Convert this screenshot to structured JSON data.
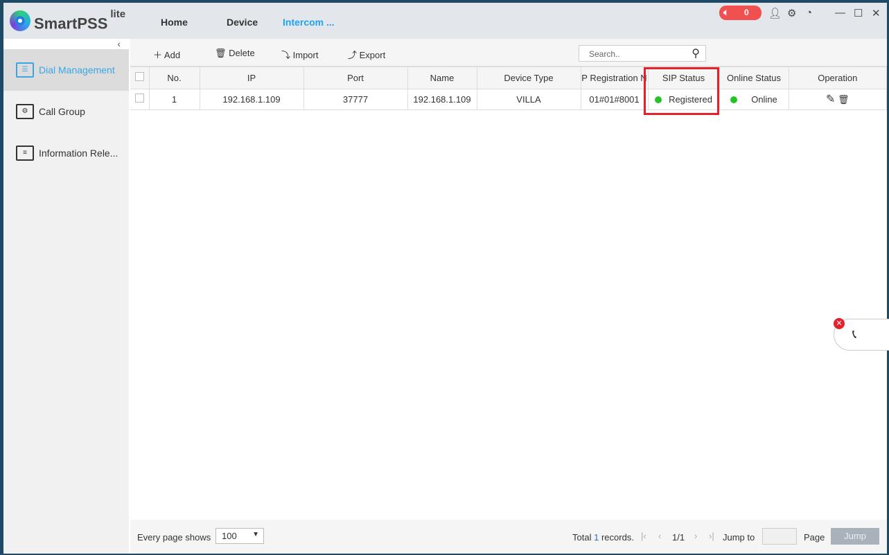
{
  "app": {
    "name": "SmartPSS",
    "suffix": "lite",
    "nav": [
      "Home",
      "Device",
      "Intercom ..."
    ],
    "alarm_count": "0"
  },
  "sidebar": {
    "items": [
      "Dial Management",
      "Call Group",
      "Information Rele..."
    ]
  },
  "toolbar": {
    "add": "Add",
    "delete": "Delete",
    "import": "Import",
    "export": "Export",
    "search_placeholder": "Search.."
  },
  "table": {
    "headers": [
      "No.",
      "IP",
      "Port",
      "Name",
      "Device Type",
      "P Registration N",
      "SIP Status",
      "Online Status",
      "Operation"
    ],
    "rows": [
      {
        "no": "1",
        "ip": "192.168.1.109",
        "port": "37777",
        "name": "192.168.1.109",
        "type": "VILLA",
        "reg": "01#01#8001",
        "sip": "Registered",
        "online": "Online"
      }
    ]
  },
  "footer": {
    "page_shows_label": "Every page shows",
    "page_size": "100",
    "total_pre": "Total",
    "total": "1",
    "total_post": "records.",
    "page": "1/1",
    "jump_to": "Jump to",
    "page_label": "Page",
    "jump": "Jump"
  }
}
